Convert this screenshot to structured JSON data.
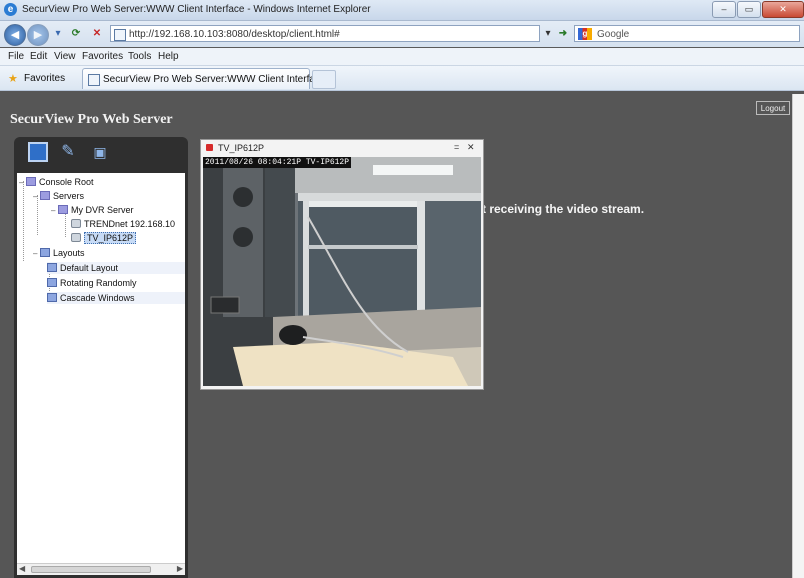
{
  "browser": {
    "window_title": "SecurView Pro Web Server:WWW Client Interface - Windows Internet Explorer",
    "address": "http://192.168.10.103:8080/desktop/client.html#",
    "search_placeholder": "Google",
    "menu": [
      "File",
      "Edit",
      "View",
      "Favorites",
      "Tools",
      "Help"
    ],
    "favorites_label": "Favorites",
    "tab_title": "SecurView Pro Web Server:WWW Client Interface",
    "win_min": "–",
    "win_max": "▭",
    "win_close": "✕"
  },
  "app": {
    "title": "SecurView Pro Web Server",
    "logout_label": "Logout",
    "status_message": "t receiving the video stream."
  },
  "tree": {
    "root": "Console Root",
    "servers": "Servers",
    "server_name": "My DVR Server",
    "camera1": "TRENDnet 192.168.10",
    "camera2": "TV_IP612P",
    "layouts": "Layouts",
    "layout1": "Default Layout",
    "layout2": "Rotating Randomly",
    "layout3": "Cascade Windows"
  },
  "video": {
    "window_title": "TV_IP612P",
    "osd_text": "2011/08/26 08:04:21P TV-IP612P",
    "minimize_glyph": "=",
    "close_glyph": "✕"
  },
  "colors": {
    "app_background": "#565656",
    "sidebar_frame": "#2f2f2f",
    "selected_item": "#c7dbf6",
    "record_dot": "#d62b2b"
  },
  "icons": {
    "sidebar_tabs": [
      "console-icon",
      "wrench-icon",
      "monitor-icon"
    ]
  }
}
